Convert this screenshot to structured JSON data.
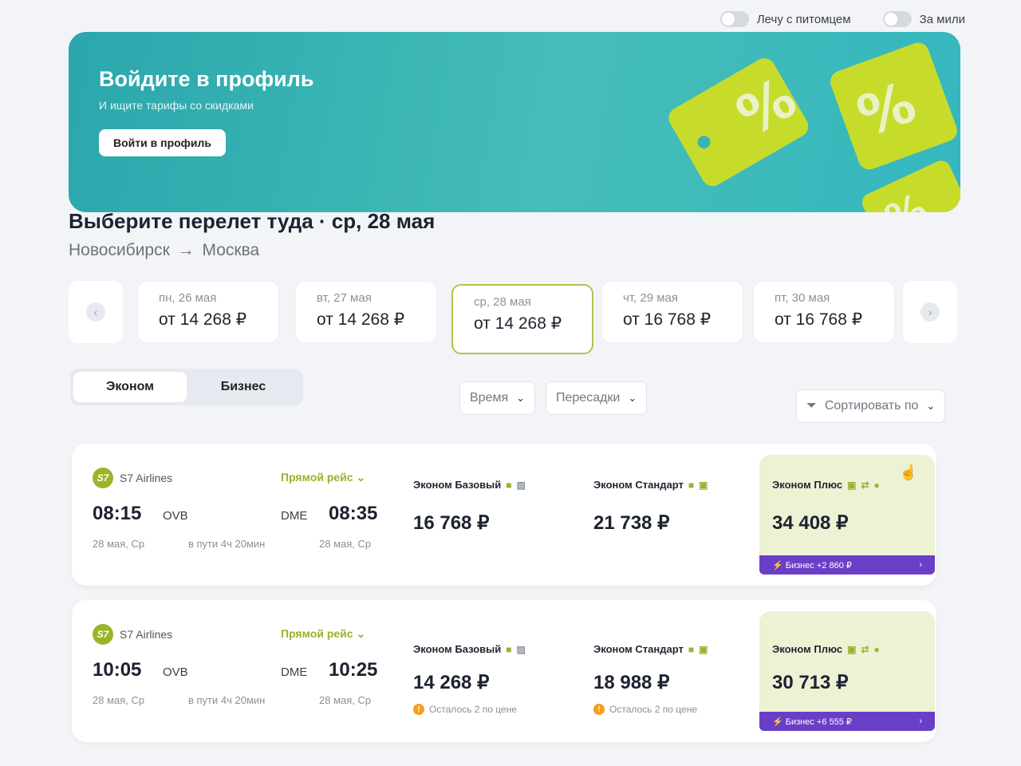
{
  "toggles": {
    "pet": "Лечу с питомцем",
    "miles": "За мили"
  },
  "banner": {
    "title": "Войдите в профиль",
    "subtitle": "И ищите тарифы со скидками",
    "button": "Войти в профиль"
  },
  "heading": "Выберите перелет туда · ср, 28 мая",
  "route": {
    "from": "Новосибирск",
    "arrow": "→",
    "to": "Москва"
  },
  "dates": [
    {
      "label": "пн, 26 мая",
      "price": "от 14 268 ₽"
    },
    {
      "label": "вт, 27 мая",
      "price": "от 14 268 ₽"
    },
    {
      "label": "ср, 28 мая",
      "price": "от 14 268 ₽"
    },
    {
      "label": "чт, 29 мая",
      "price": "от 16 768 ₽"
    },
    {
      "label": "пт, 30 мая",
      "price": "от 16 768 ₽"
    }
  ],
  "classes": {
    "economy": "Эконом",
    "business": "Бизнес"
  },
  "filters": {
    "time": "Время",
    "transfers": "Пересадки",
    "sort": "Сортировать по"
  },
  "flights": [
    {
      "airline": "S7 Airlines",
      "logo": "S7",
      "direct": "Прямой рейс",
      "dep_time": "08:15",
      "dep_code": "OVB",
      "dep_date": "28 мая, Ср",
      "arr_time": "08:35",
      "arr_code": "DME",
      "arr_date": "28 мая, Ср",
      "duration": "в пути 4ч 20мин",
      "fares": [
        {
          "name": "Эконом Базовый",
          "price": "16 768 ₽",
          "note": ""
        },
        {
          "name": "Эконом Стандарт",
          "price": "21 738 ₽",
          "note": ""
        },
        {
          "name": "Эконом Плюс",
          "price": "34 408 ₽",
          "upgrade": "Бизнес +2 860 ₽"
        }
      ]
    },
    {
      "airline": "S7 Airlines",
      "logo": "S7",
      "direct": "Прямой рейс",
      "dep_time": "10:05",
      "dep_code": "OVB",
      "dep_date": "28 мая, Ср",
      "arr_time": "10:25",
      "arr_code": "DME",
      "arr_date": "28 мая, Ср",
      "duration": "в пути 4ч 20мин",
      "fares": [
        {
          "name": "Эконом Базовый",
          "price": "14 268 ₽",
          "note": "Осталось 2 по цене"
        },
        {
          "name": "Эконом Стандарт",
          "price": "18 988 ₽",
          "note": "Осталось 2 по цене"
        },
        {
          "name": "Эконом Плюс",
          "price": "30 713 ₽",
          "upgrade": "Бизнес +6 555 ₽"
        }
      ]
    }
  ],
  "colors": {
    "accent": "#9cb02d",
    "upgrade": "#6a3fc8",
    "banner": "#2aa7ad"
  }
}
